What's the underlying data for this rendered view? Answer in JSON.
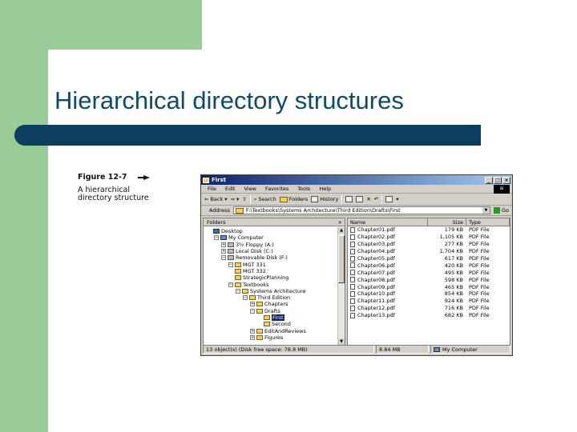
{
  "slide": {
    "title": "Hierarchical directory structures"
  },
  "figure": {
    "number": "Figure 12-7",
    "description": "A hierarchical directory structure"
  },
  "window": {
    "title": "First",
    "menu": [
      "File",
      "Edit",
      "View",
      "Favorites",
      "Tools",
      "Help"
    ],
    "toolbar": {
      "back": "Back",
      "search": "Search",
      "folders": "Folders",
      "history": "History"
    },
    "address_label": "Address",
    "address_value": "F:\\Textbooks\\Systems Architecture\\Third Edition\\Drafts\\First",
    "go_label": "Go",
    "folders_pane": {
      "header": "Folders",
      "close": "×",
      "tree": [
        {
          "label": "Desktop",
          "level": 0,
          "toggle": "",
          "icon": "desktop-icon"
        },
        {
          "label": "My Computer",
          "level": 1,
          "toggle": "−",
          "icon": "computer-icon"
        },
        {
          "label": "3½ Floppy (A:)",
          "level": 2,
          "toggle": "+",
          "icon": "floppy-drive-icon"
        },
        {
          "label": "Local Disk (C:)",
          "level": 2,
          "toggle": "+",
          "icon": "disk-drive-icon"
        },
        {
          "label": "Removable Disk (F:)",
          "level": 2,
          "toggle": "−",
          "icon": "removable-disk-icon"
        },
        {
          "label": "MGT 331",
          "level": 3,
          "toggle": "−",
          "icon": "folder-icon"
        },
        {
          "label": "MGT 332",
          "level": 3,
          "toggle": "",
          "icon": "folder-icon"
        },
        {
          "label": "StrategicPlanning",
          "level": 3,
          "toggle": "",
          "icon": "folder-icon"
        },
        {
          "label": "Textbooks",
          "level": 3,
          "toggle": "−",
          "icon": "folder-icon"
        },
        {
          "label": "Systems Architecture",
          "level": 4,
          "toggle": "−",
          "icon": "folder-icon"
        },
        {
          "label": "Third Edition",
          "level": 5,
          "toggle": "−",
          "icon": "folder-icon"
        },
        {
          "label": "Chapters",
          "level": 6,
          "toggle": "+",
          "icon": "folder-icon"
        },
        {
          "label": "Drafts",
          "level": 6,
          "toggle": "−",
          "icon": "folder-icon"
        },
        {
          "label": "First",
          "level": 7,
          "toggle": "",
          "icon": "open-folder-icon",
          "selected": true
        },
        {
          "label": "Second",
          "level": 7,
          "toggle": "",
          "icon": "folder-icon"
        },
        {
          "label": "EditAndReviews",
          "level": 6,
          "toggle": "+",
          "icon": "folder-icon"
        },
        {
          "label": "Figures",
          "level": 6,
          "toggle": "+",
          "icon": "folder-icon"
        }
      ]
    },
    "files_pane": {
      "columns": {
        "name": "Name",
        "size": "Size",
        "type": "Type"
      },
      "files": [
        {
          "name": "Chapter01.pdf",
          "size": "179 KB",
          "type": "PDF File"
        },
        {
          "name": "Chapter02.pdf",
          "size": "1,105 KB",
          "type": "PDF File"
        },
        {
          "name": "Chapter03.pdf",
          "size": "277 KB",
          "type": "PDF File"
        },
        {
          "name": "Chapter04.pdf",
          "size": "1,704 KB",
          "type": "PDF File"
        },
        {
          "name": "Chapter05.pdf",
          "size": "617 KB",
          "type": "PDF File"
        },
        {
          "name": "Chapter06.pdf",
          "size": "420 KB",
          "type": "PDF File"
        },
        {
          "name": "Chapter07.pdf",
          "size": "495 KB",
          "type": "PDF File"
        },
        {
          "name": "Chapter08.pdf",
          "size": "598 KB",
          "type": "PDF File"
        },
        {
          "name": "Chapter09.pdf",
          "size": "465 KB",
          "type": "PDF File"
        },
        {
          "name": "Chapter10.pdf",
          "size": "854 KB",
          "type": "PDF File"
        },
        {
          "name": "Chapter11.pdf",
          "size": "924 KB",
          "type": "PDF File"
        },
        {
          "name": "Chapter12.pdf",
          "size": "716 KB",
          "type": "PDF File"
        },
        {
          "name": "Chapter13.pdf",
          "size": "682 KB",
          "type": "PDF File"
        }
      ]
    },
    "status": {
      "objects": "13 object(s) (Disk free space: 78.8 MB)",
      "size": "8.84 MB",
      "location": "My Computer"
    }
  }
}
